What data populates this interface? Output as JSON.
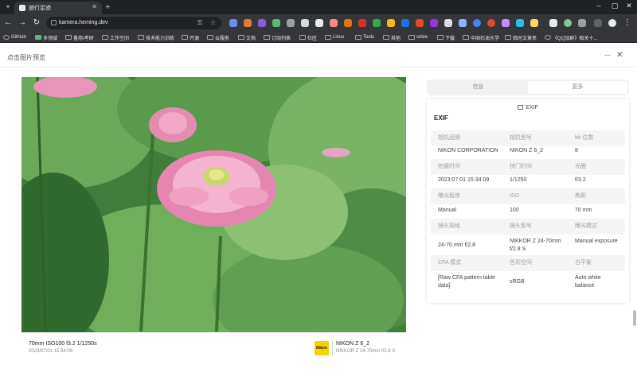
{
  "browser": {
    "tab_title": "旅行足迹",
    "url": "kamera.heming.dev",
    "bookmarks": [
      "GitHub",
      "多领域",
      "量用/考研",
      "工作空间",
      "技术能力训练",
      "开源",
      "云服务",
      "文档",
      "订阅列表",
      "社区",
      "Linux",
      "Tools",
      "其他",
      "solve",
      "下载",
      "中国石油大学",
      "临时文章夹",
      "《QQ加群》相关十..."
    ]
  },
  "page": {
    "title": "点击图片预览"
  },
  "photo": {
    "caption_line1": "70mm ISO100 f3.2 1/1250s",
    "caption_line2": "2023/07/01 15:34:09",
    "brand_logo": "Nikon",
    "camera_model": "NIKON Z 6_2",
    "lens_model": "NIKKOR Z 24-70mm f/2.8 S"
  },
  "panel": {
    "tabs": [
      "信息",
      "更多"
    ],
    "active_tab": "更多",
    "exif_header": "EXIF",
    "exif_title": "EXIF",
    "rows": [
      {
        "labels": [
          "相机品牌",
          "相机型号",
          "bit 位数"
        ],
        "values": [
          "NIKON CORPORATION",
          "NIKON Z 6_2",
          "8"
        ]
      },
      {
        "labels": [
          "拍摄时间",
          "快门时间",
          "光圈"
        ],
        "values": [
          "2023:07:01 15:34:09",
          "1/1250",
          "f/3.2"
        ]
      },
      {
        "labels": [
          "曝光程序",
          "ISO",
          "焦距"
        ],
        "values": [
          "Manual",
          "100",
          "70 mm"
        ]
      },
      {
        "labels": [
          "镜头规格",
          "镜头型号",
          "曝光模式"
        ],
        "values": [
          "24-70 mm f/2.8",
          "NIKKOR Z 24-70mm f/2.8 S",
          "Manual exposure"
        ]
      },
      {
        "labels": [
          "CFA 模式",
          "色彩空间",
          "白平衡"
        ],
        "values": [
          "[Raw CFA pattern table data]",
          "sRGB",
          "Auto white balance"
        ]
      }
    ]
  }
}
